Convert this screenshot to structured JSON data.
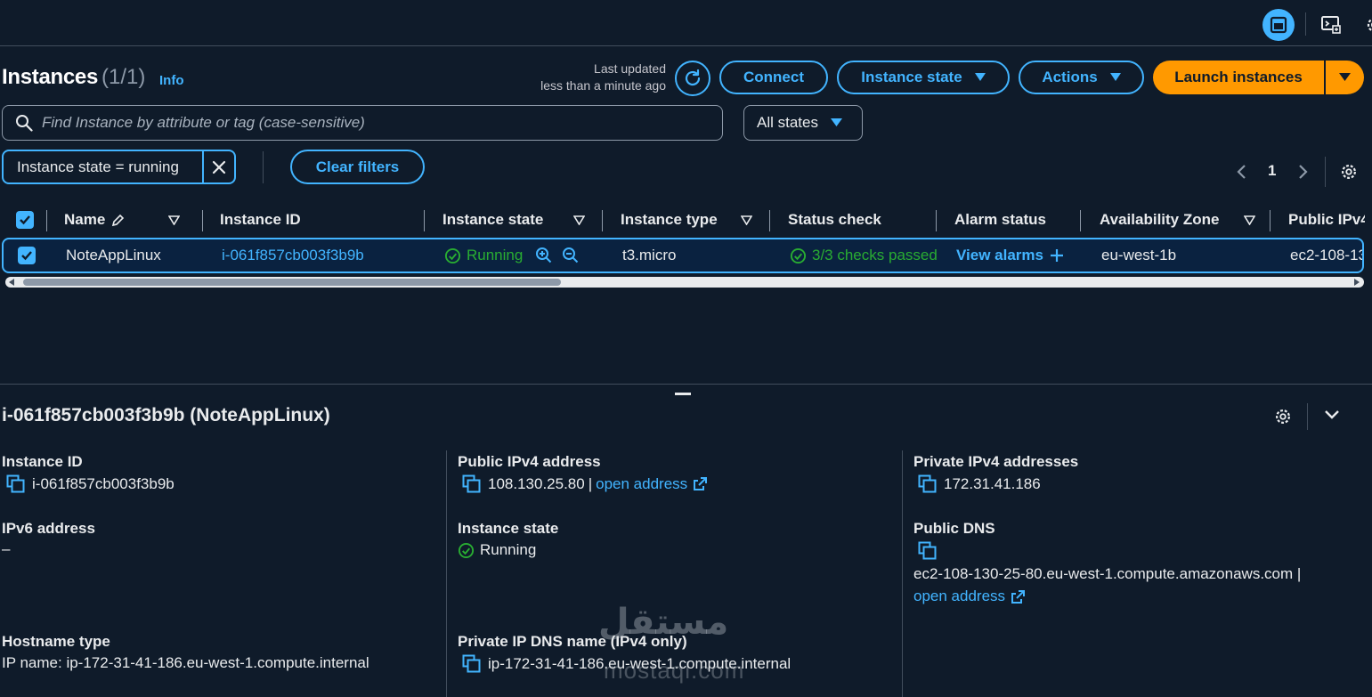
{
  "header": {
    "title": "Instances",
    "count": "(1/1)",
    "info": "Info",
    "last_updated_1": "Last updated",
    "last_updated_2": "less than a minute ago",
    "connect": "Connect",
    "instance_state": "Instance state",
    "actions": "Actions",
    "launch": "Launch instances"
  },
  "search": {
    "placeholder": "Find Instance by attribute or tag (case-sensitive)",
    "states_select": "All states"
  },
  "filter": {
    "token": "Instance state = running",
    "clear": "Clear filters"
  },
  "pagination": {
    "page": "1"
  },
  "table": {
    "columns": [
      "Name",
      "Instance ID",
      "Instance state",
      "Instance type",
      "Status check",
      "Alarm status",
      "Availability Zone",
      "Public IPv4"
    ],
    "row": {
      "name": "NoteAppLinux",
      "id": "i-061f857cb003f3b9b",
      "state": "Running",
      "type": "t3.micro",
      "status": "3/3 checks passed",
      "alarm": "View alarms",
      "az": "eu-west-1b",
      "public_dns": "ec2-108-130-25-80.eu-west-1.compute.amazonaws.com"
    }
  },
  "details": {
    "title": "i-061f857cb003f3b9b (NoteAppLinux)",
    "instance_id_label": "Instance ID",
    "instance_id": "i-061f857cb003f3b9b",
    "public_ip_label": "Public IPv4 address",
    "public_ip": "108.130.25.80",
    "separator": "|",
    "open_address": "open address",
    "private_ip_label": "Private IPv4 addresses",
    "private_ip": "172.31.41.186",
    "ipv6_label": "IPv6 address",
    "ipv6": "–",
    "state_label": "Instance state",
    "state": "Running",
    "public_dns_label": "Public DNS",
    "public_dns": "ec2-108-130-25-80.eu-west-1.compute.amazonaws.com |",
    "hostname_label": "Hostname type",
    "hostname": "IP name: ip-172-31-41-186.eu-west-1.compute.internal",
    "private_dns_label": "Private IP DNS name (IPv4 only)",
    "private_dns": "ip-172-31-41-186.eu-west-1.compute.internal"
  },
  "watermark": {
    "arabic": "مستقل",
    "latin": "mostaql.com"
  },
  "colors": {
    "accent": "#42b4ff",
    "launch": "#ff9900",
    "success": "#29ad32",
    "background": "#0f1b2a"
  },
  "icons": [
    "layout-panel-icon",
    "cloudshell-icon",
    "settings-icon",
    "refresh-icon",
    "caret-down-icon",
    "search-icon",
    "close-icon",
    "chevron-left-icon",
    "chevron-right-icon",
    "edit-icon",
    "filter-icon",
    "check-circle-icon",
    "zoom-in-icon",
    "zoom-out-icon",
    "plus-icon",
    "copy-icon",
    "external-link-icon",
    "chevron-down-icon"
  ]
}
